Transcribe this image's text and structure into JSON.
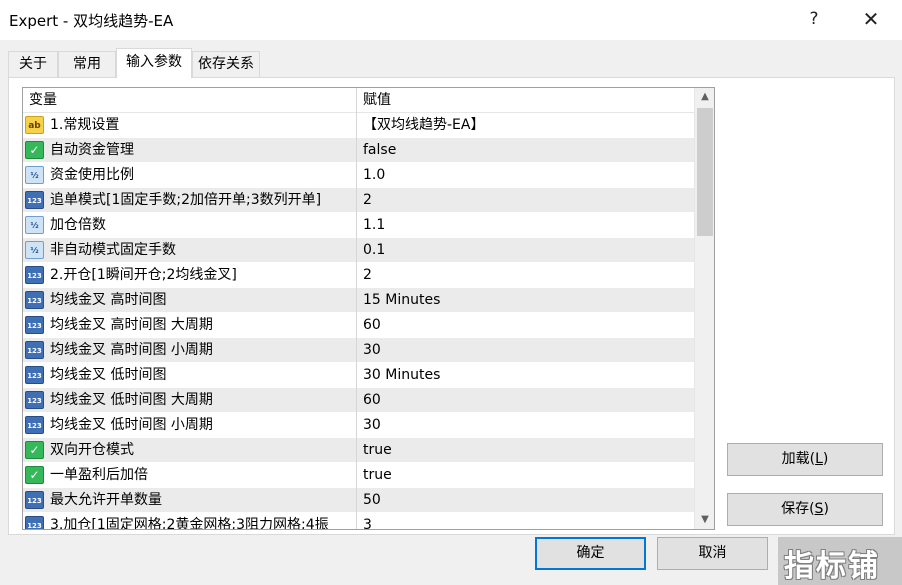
{
  "window": {
    "title": "Expert - 双均线趋势-EA",
    "help": "?",
    "close": "✕"
  },
  "tabs": [
    {
      "label": "关于",
      "active": false
    },
    {
      "label": "常用",
      "active": false
    },
    {
      "label": "输入参数",
      "active": true
    },
    {
      "label": "依存关系",
      "active": false
    }
  ],
  "grid": {
    "col_variable": "变量",
    "col_value": "赋值",
    "rows": [
      {
        "icon": "string-icon",
        "icon_text": "ab",
        "name": "1.常规设置",
        "value": "【双均线趋势-EA】"
      },
      {
        "icon": "bool-icon",
        "icon_text": "✓",
        "name": "自动资金管理",
        "value": "false"
      },
      {
        "icon": "double-icon",
        "icon_text": "½",
        "name": "资金使用比例",
        "value": "1.0"
      },
      {
        "icon": "int-icon",
        "icon_text": "123",
        "name": "追单模式[1固定手数;2加倍开单;3数列开单]",
        "value": "2"
      },
      {
        "icon": "double-icon",
        "icon_text": "½",
        "name": "加仓倍数",
        "value": "1.1"
      },
      {
        "icon": "double-icon",
        "icon_text": "½",
        "name": "非自动模式固定手数",
        "value": "0.1"
      },
      {
        "icon": "int-icon",
        "icon_text": "123",
        "name": "2.开仓[1瞬间开仓;2均线金叉]",
        "value": "2"
      },
      {
        "icon": "int-icon",
        "icon_text": "123",
        "name": "均线金叉 高时间图",
        "value": "15 Minutes"
      },
      {
        "icon": "int-icon",
        "icon_text": "123",
        "name": "均线金叉 高时间图 大周期",
        "value": "60"
      },
      {
        "icon": "int-icon",
        "icon_text": "123",
        "name": "均线金叉 高时间图 小周期",
        "value": "30"
      },
      {
        "icon": "int-icon",
        "icon_text": "123",
        "name": "均线金叉 低时间图",
        "value": "30 Minutes"
      },
      {
        "icon": "int-icon",
        "icon_text": "123",
        "name": "均线金叉 低时间图 大周期",
        "value": "60"
      },
      {
        "icon": "int-icon",
        "icon_text": "123",
        "name": "均线金叉 低时间图 小周期",
        "value": "30"
      },
      {
        "icon": "bool-icon",
        "icon_text": "✓",
        "name": "双向开仓模式",
        "value": "true"
      },
      {
        "icon": "bool-icon",
        "icon_text": "✓",
        "name": "一单盈利后加倍",
        "value": "true"
      },
      {
        "icon": "int-icon",
        "icon_text": "123",
        "name": "最大允许开单数量",
        "value": "50"
      },
      {
        "icon": "int-icon",
        "icon_text": "123",
        "name": "3.加仓[1固定网格;2黄金网格;3阻力网格;4振",
        "value": "3"
      }
    ]
  },
  "buttons": {
    "load_prefix": "加载(",
    "load_key": "L",
    "load_suffix": ")",
    "save_prefix": "保存(",
    "save_key": "S",
    "save_suffix": ")",
    "ok": "确定",
    "cancel": "取消"
  },
  "watermark": "指标铺",
  "colors": {
    "accent": "#0078d7",
    "row_alt": "#ebebeb",
    "button_face": "#e1e1e1"
  }
}
